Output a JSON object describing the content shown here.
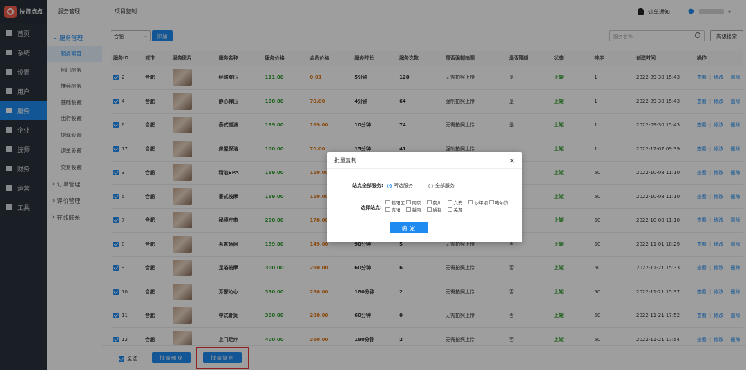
{
  "app": {
    "name": "技师点点"
  },
  "nav": [
    {
      "label": "首页",
      "icon": "monitor-icon"
    },
    {
      "label": "系统",
      "icon": "org-icon"
    },
    {
      "label": "设置",
      "icon": "gear-icon"
    },
    {
      "label": "用户",
      "icon": "user-icon"
    },
    {
      "label": "服务",
      "icon": "link-icon"
    },
    {
      "label": "企业",
      "icon": "building-icon"
    },
    {
      "label": "技师",
      "icon": "person-icon"
    },
    {
      "label": "财务",
      "icon": "org-icon"
    },
    {
      "label": "运营",
      "icon": "chart-icon"
    },
    {
      "label": "工具",
      "icon": "briefcase-icon"
    }
  ],
  "nav_active": 4,
  "sub": {
    "title": "服务管理",
    "group_open": "服务管理",
    "items": [
      "服务项目",
      "热门服务",
      "推荐服务",
      "基础设置",
      "出行设置",
      "提现设置",
      "退单设置",
      "交易设置"
    ],
    "groups_closed": [
      "订单管理",
      "评价管理",
      "在线联系"
    ]
  },
  "header": {
    "breadcrumb": "项目复制",
    "notice": "订单通知"
  },
  "toolbar": {
    "city": "合肥",
    "add": "添加",
    "search_placeholder": "服务名称",
    "advanced": "高级搜索"
  },
  "table": {
    "columns": [
      "服务ID",
      "城市",
      "服务图片",
      "服务名称",
      "服务价格",
      "会员价格",
      "服务时长",
      "服务次数",
      "是否强制拍照",
      "是否渠道",
      "状态",
      "排序",
      "创建时间",
      "操作"
    ],
    "rows": [
      {
        "id": "2",
        "city": "合肥",
        "name": "经络舒压",
        "price": "111.00",
        "mprice": "0.01",
        "dur": "5分钟",
        "count": "120",
        "photo": "无需拍照上传",
        "channel": "是",
        "status": "上架",
        "sort": "1",
        "time": "2022-09-30 15:43"
      },
      {
        "id": "4",
        "city": "合肥",
        "name": "静心释压",
        "price": "100.00",
        "mprice": "70.00",
        "dur": "4分钟",
        "count": "64",
        "photo": "强制拍照上传",
        "channel": "是",
        "status": "上架",
        "sort": "1",
        "time": "2022-09-30 15:43"
      },
      {
        "id": "6",
        "city": "合肥",
        "name": "泰式搓澡",
        "price": "199.00",
        "mprice": "169.00",
        "dur": "10分钟",
        "count": "74",
        "photo": "无需拍照上传",
        "channel": "是",
        "status": "上架",
        "sort": "1",
        "time": "2022-09-30 15:43"
      },
      {
        "id": "17",
        "city": "合肥",
        "name": "房屋保洁",
        "price": "100.00",
        "mprice": "70.00",
        "dur": "15分钟",
        "count": "41",
        "photo": "强制拍照上传",
        "channel": "",
        "status": "上架",
        "sort": "1",
        "time": "2022-12-07 09:39"
      },
      {
        "id": "3",
        "city": "合肥",
        "name": "精油SPA",
        "price": "169.00",
        "mprice": "159.00",
        "dur": "",
        "count": "",
        "photo": "",
        "channel": "",
        "status": "上架",
        "sort": "50",
        "time": "2022-10-08 11:10"
      },
      {
        "id": "5",
        "city": "合肥",
        "name": "泰式按摩",
        "price": "169.00",
        "mprice": "159.00",
        "dur": "",
        "count": "",
        "photo": "",
        "channel": "",
        "status": "上架",
        "sort": "50",
        "time": "2022-10-08 11:10"
      },
      {
        "id": "7",
        "city": "合肥",
        "name": "秘境疗愈",
        "price": "200.00",
        "mprice": "170.00",
        "dur": "",
        "count": "",
        "photo": "",
        "channel": "",
        "status": "上架",
        "sort": "50",
        "time": "2022-10-08 11:10"
      },
      {
        "id": "8",
        "city": "合肥",
        "name": "茗茶休闲",
        "price": "159.00",
        "mprice": "149.00",
        "dur": "90分钟",
        "count": "5",
        "photo": "无需拍照上传",
        "channel": "否",
        "status": "上架",
        "sort": "50",
        "time": "2022-11-01 18:29"
      },
      {
        "id": "9",
        "city": "合肥",
        "name": "足浴按摩",
        "price": "300.00",
        "mprice": "260.00",
        "dur": "60分钟",
        "count": "6",
        "photo": "无需拍照上传",
        "channel": "否",
        "status": "上架",
        "sort": "50",
        "time": "2022-11-21 15:33"
      },
      {
        "id": "10",
        "city": "合肥",
        "name": "芳瑟沁心",
        "price": "330.00",
        "mprice": "280.00",
        "dur": "180分钟",
        "count": "2",
        "photo": "无需拍照上传",
        "channel": "否",
        "status": "上架",
        "sort": "50",
        "time": "2022-11-21 15:37"
      },
      {
        "id": "11",
        "city": "合肥",
        "name": "中式針灸",
        "price": "300.00",
        "mprice": "200.00",
        "dur": "60分钟",
        "count": "0",
        "photo": "无需拍照上传",
        "channel": "否",
        "status": "上架",
        "sort": "50",
        "time": "2022-11-21 17:52"
      },
      {
        "id": "12",
        "city": "合肥",
        "name": "上门足疗",
        "price": "400.00",
        "mprice": "360.00",
        "dur": "180分钟",
        "count": "2",
        "photo": "无需拍照上传",
        "channel": "否",
        "status": "上架",
        "sort": "50",
        "time": "2022-11-21 17:54"
      }
    ],
    "ops": [
      "查看",
      "修改",
      "删除"
    ]
  },
  "footer": {
    "select_all": "全选",
    "batch_delete": "批量删除",
    "batch_copy": "批量复制"
  },
  "modal": {
    "title": "批量复制",
    "close": "×",
    "label_all": "站点全部服务:",
    "opt_selected": "所选服务",
    "opt_all": "全部服务",
    "label_sites": "选择站点:",
    "sites": [
      "鹤阳区",
      "南京",
      "南川",
      "六安",
      "沙坪坝",
      "哈尔滨",
      "贵阳",
      "越南",
      "成都",
      "芜湖"
    ],
    "confirm": "确 定"
  },
  "colors": {
    "primary": "#1f8bf0",
    "nav_bg": "#2b333d",
    "price": "#2f9d2f",
    "member_price": "#e07b1d",
    "highlight": "#e53935"
  }
}
